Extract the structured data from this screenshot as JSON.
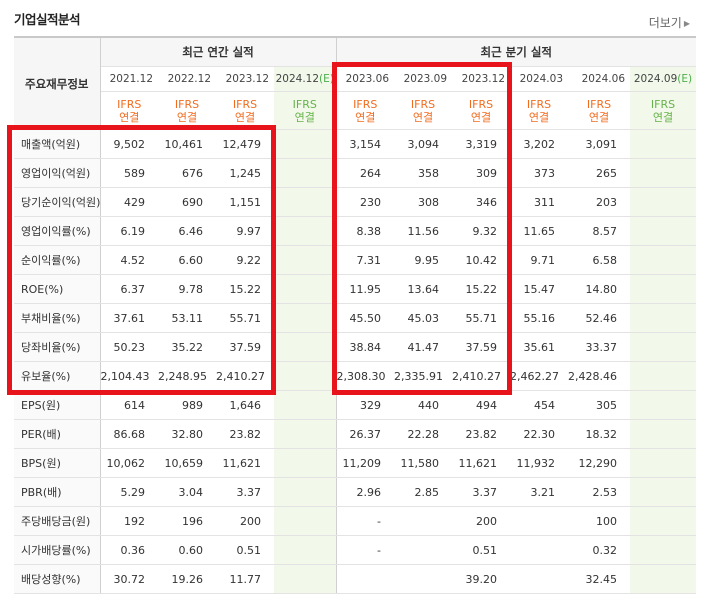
{
  "section_title": "기업실적분석",
  "more_link": "더보기",
  "row_header_label": "주요재무정보",
  "annual_group_label": "최근 연간 실적",
  "quarter_group_label": "최근 분기 실적",
  "periods": [
    {
      "label": "2021.12",
      "estimate": false,
      "basis1": "IFRS",
      "basis2": "연결"
    },
    {
      "label": "2022.12",
      "estimate": false,
      "basis1": "IFRS",
      "basis2": "연결"
    },
    {
      "label": "2023.12",
      "estimate": false,
      "basis1": "IFRS",
      "basis2": "연결"
    },
    {
      "label": "2024.12",
      "estimate_mark": "(E)",
      "estimate": true,
      "basis1": "IFRS",
      "basis2": "연결"
    },
    {
      "label": "2023.06",
      "estimate": false,
      "basis1": "IFRS",
      "basis2": "연결"
    },
    {
      "label": "2023.09",
      "estimate": false,
      "basis1": "IFRS",
      "basis2": "연결"
    },
    {
      "label": "2023.12",
      "estimate": false,
      "basis1": "IFRS",
      "basis2": "연결"
    },
    {
      "label": "2024.03",
      "estimate": false,
      "basis1": "IFRS",
      "basis2": "연결"
    },
    {
      "label": "2024.06",
      "estimate": false,
      "basis1": "IFRS",
      "basis2": "연결"
    },
    {
      "label": "2024.09",
      "estimate_mark": "(E)",
      "estimate": true,
      "basis1": "IFRS",
      "basis2": "연결"
    }
  ],
  "rows": [
    {
      "label": "매출액(억원)",
      "values": [
        "9,502",
        "10,461",
        "12,479",
        "",
        "3,154",
        "3,094",
        "3,319",
        "3,202",
        "3,091",
        ""
      ]
    },
    {
      "label": "영업이익(억원)",
      "values": [
        "589",
        "676",
        "1,245",
        "",
        "264",
        "358",
        "309",
        "373",
        "265",
        ""
      ]
    },
    {
      "label": "당기순이익(억원)",
      "values": [
        "429",
        "690",
        "1,151",
        "",
        "230",
        "308",
        "346",
        "311",
        "203",
        ""
      ]
    },
    {
      "label": "영업이익률(%)",
      "values": [
        "6.19",
        "6.46",
        "9.97",
        "",
        "8.38",
        "11.56",
        "9.32",
        "11.65",
        "8.57",
        ""
      ]
    },
    {
      "label": "순이익률(%)",
      "values": [
        "4.52",
        "6.60",
        "9.22",
        "",
        "7.31",
        "9.95",
        "10.42",
        "9.71",
        "6.58",
        ""
      ]
    },
    {
      "label": "ROE(%)",
      "values": [
        "6.37",
        "9.78",
        "15.22",
        "",
        "11.95",
        "13.64",
        "15.22",
        "15.47",
        "14.80",
        ""
      ]
    },
    {
      "label": "부채비율(%)",
      "values": [
        "37.61",
        "53.11",
        "55.71",
        "",
        "45.50",
        "45.03",
        "55.71",
        "55.16",
        "52.46",
        ""
      ]
    },
    {
      "label": "당좌비율(%)",
      "values": [
        "50.23",
        "35.22",
        "37.59",
        "",
        "38.84",
        "41.47",
        "37.59",
        "35.61",
        "33.37",
        ""
      ]
    },
    {
      "label": "유보율(%)",
      "values": [
        "2,104.43",
        "2,248.95",
        "2,410.27",
        "",
        "2,308.30",
        "2,335.91",
        "2,410.27",
        "2,462.27",
        "2,428.46",
        ""
      ]
    },
    {
      "label": "EPS(원)",
      "values": [
        "614",
        "989",
        "1,646",
        "",
        "329",
        "440",
        "494",
        "454",
        "305",
        ""
      ]
    },
    {
      "label": "PER(배)",
      "values": [
        "86.68",
        "32.80",
        "23.82",
        "",
        "26.37",
        "22.28",
        "23.82",
        "22.30",
        "18.32",
        ""
      ]
    },
    {
      "label": "BPS(원)",
      "values": [
        "10,062",
        "10,659",
        "11,621",
        "",
        "11,209",
        "11,580",
        "11,621",
        "11,932",
        "12,290",
        ""
      ]
    },
    {
      "label": "PBR(배)",
      "values": [
        "5.29",
        "3.04",
        "3.37",
        "",
        "2.96",
        "2.85",
        "3.37",
        "3.21",
        "2.53",
        ""
      ]
    },
    {
      "label": "주당배당금(원)",
      "values": [
        "192",
        "196",
        "200",
        "",
        "-",
        "",
        "200",
        "",
        "100",
        ""
      ]
    },
    {
      "label": "시가배당률(%)",
      "values": [
        "0.36",
        "0.60",
        "0.51",
        "",
        "-",
        "",
        "0.51",
        "",
        "0.32",
        ""
      ]
    },
    {
      "label": "배당성향(%)",
      "values": [
        "30.72",
        "19.26",
        "11.77",
        "",
        "",
        "",
        "39.20",
        "",
        "32.45",
        ""
      ]
    }
  ],
  "group_starts": [
    3,
    6,
    9,
    13
  ],
  "highlight_color": "#e8141c"
}
